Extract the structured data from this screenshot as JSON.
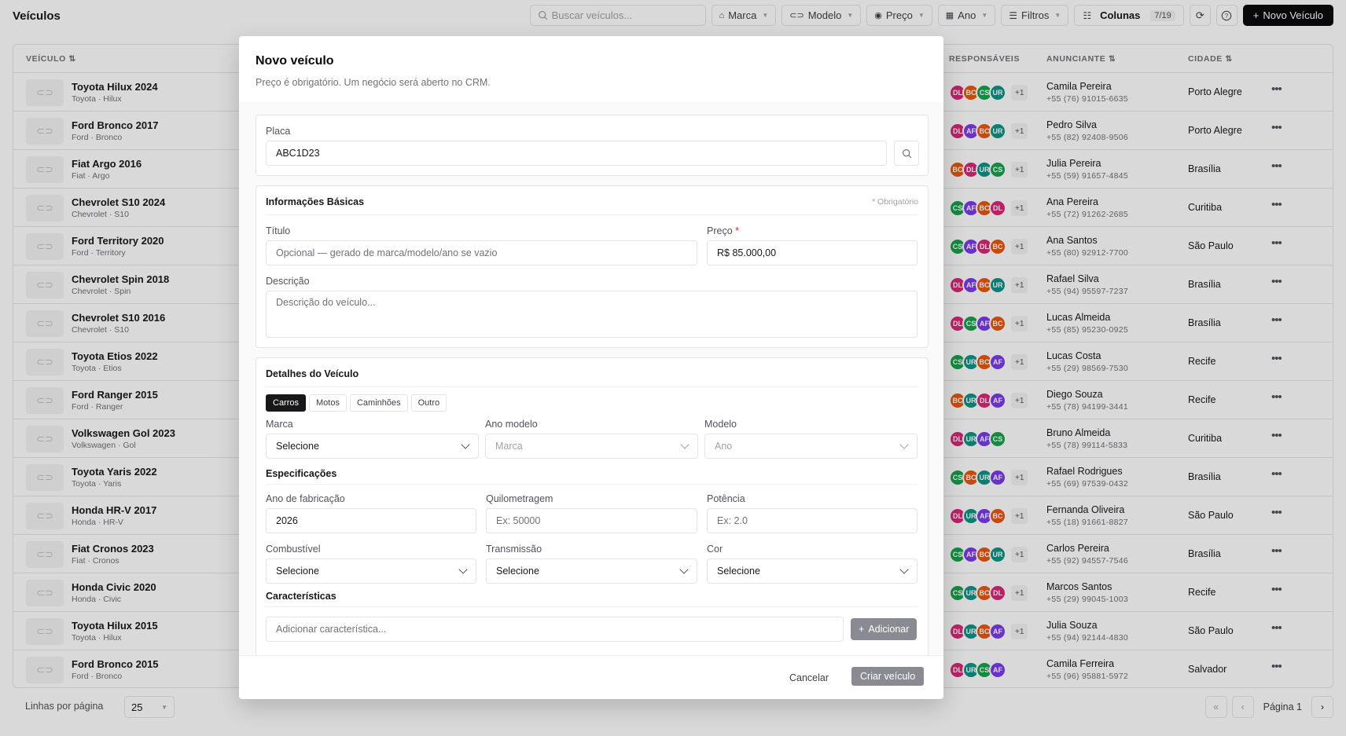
{
  "header": {
    "title": "Veículos",
    "search_placeholder": "Buscar veículos...",
    "filters": [
      "Marca",
      "Modelo",
      "Preço",
      "Ano",
      "Filtros"
    ],
    "columns_label": "Colunas",
    "columns_count": "7/19",
    "new_button": "Novo Veículo"
  },
  "table": {
    "columns": {
      "vehicle": "VEÍCULO",
      "responsibles": "RESPONSÁVEIS",
      "advertiser": "ANUNCIANTE",
      "city": "CIDADE"
    },
    "rows": [
      {
        "name": "Toyota Hilux 2024",
        "sub": "Toyota · Hilux",
        "avatars": [
          "DL",
          "BC",
          "CS",
          "UR"
        ],
        "more": "+1",
        "advertiser": "Camila Pereira",
        "phone": "+55 (76) 91015-6635",
        "city": "Porto Alegre"
      },
      {
        "name": "Ford Bronco 2017",
        "sub": "Ford · Bronco",
        "avatars": [
          "DL",
          "AF",
          "BC",
          "UR"
        ],
        "more": "+1",
        "advertiser": "Pedro Silva",
        "phone": "+55 (82) 92408-9506",
        "city": "Porto Alegre"
      },
      {
        "name": "Fiat Argo 2016",
        "sub": "Fiat · Argo",
        "avatars": [
          "BC",
          "DL",
          "UR",
          "CS"
        ],
        "more": "+1",
        "advertiser": "Julia Pereira",
        "phone": "+55 (59) 91657-4845",
        "city": "Brasília"
      },
      {
        "name": "Chevrolet S10 2024",
        "sub": "Chevrolet · S10",
        "avatars": [
          "CS",
          "AF",
          "BC",
          "DL"
        ],
        "more": "+1",
        "advertiser": "Ana Pereira",
        "phone": "+55 (72) 91262-2685",
        "city": "Curitiba"
      },
      {
        "name": "Ford Territory 2020",
        "sub": "Ford · Territory",
        "avatars": [
          "CS",
          "AF",
          "DL",
          "BC"
        ],
        "more": "+1",
        "advertiser": "Ana Santos",
        "phone": "+55 (80) 92912-7700",
        "city": "São Paulo"
      },
      {
        "name": "Chevrolet Spin 2018",
        "sub": "Chevrolet · Spin",
        "avatars": [
          "DL",
          "AF",
          "BC",
          "UR"
        ],
        "more": "+1",
        "advertiser": "Rafael Silva",
        "phone": "+55 (94) 95597-7237",
        "city": "Brasília"
      },
      {
        "name": "Chevrolet S10 2016",
        "sub": "Chevrolet · S10",
        "avatars": [
          "DL",
          "CS",
          "AF",
          "BC"
        ],
        "more": "+1",
        "advertiser": "Lucas Almeida",
        "phone": "+55 (85) 95230-0925",
        "city": "Brasília"
      },
      {
        "name": "Toyota Etios 2022",
        "sub": "Toyota · Etios",
        "avatars": [
          "CS",
          "UR",
          "BC",
          "AF"
        ],
        "more": "+1",
        "advertiser": "Lucas Costa",
        "phone": "+55 (29) 98569-7530",
        "city": "Recife"
      },
      {
        "name": "Ford Ranger 2015",
        "sub": "Ford · Ranger",
        "avatars": [
          "BC",
          "UR",
          "DL",
          "AF"
        ],
        "more": "+1",
        "advertiser": "Diego Souza",
        "phone": "+55 (78) 94199-3441",
        "city": "Recife"
      },
      {
        "name": "Volkswagen Gol 2023",
        "sub": "Volkswagen · Gol",
        "avatars": [
          "DL",
          "UR",
          "AF",
          "CS"
        ],
        "more": "",
        "advertiser": "Bruno Almeida",
        "phone": "+55 (78) 99114-5833",
        "city": "Curitiba"
      },
      {
        "name": "Toyota Yaris 2022",
        "sub": "Toyota · Yaris",
        "avatars": [
          "CS",
          "BC",
          "UR",
          "AF"
        ],
        "more": "+1",
        "advertiser": "Rafael Rodrigues",
        "phone": "+55 (69) 97539-0432",
        "city": "Brasília"
      },
      {
        "name": "Honda HR-V 2017",
        "sub": "Honda · HR-V",
        "avatars": [
          "DL",
          "UR",
          "AF",
          "BC"
        ],
        "more": "+1",
        "advertiser": "Fernanda Oliveira",
        "phone": "+55 (18) 91661-8827",
        "city": "São Paulo"
      },
      {
        "name": "Fiat Cronos 2023",
        "sub": "Fiat · Cronos",
        "avatars": [
          "CS",
          "AF",
          "BC",
          "UR"
        ],
        "more": "+1",
        "advertiser": "Carlos Pereira",
        "phone": "+55 (92) 94557-7546",
        "city": "Brasília"
      },
      {
        "name": "Honda Civic 2020",
        "sub": "Honda · Civic",
        "avatars": [
          "CS",
          "UR",
          "BC",
          "DL"
        ],
        "more": "+1",
        "advertiser": "Marcos Santos",
        "phone": "+55 (29) 99045-1003",
        "city": "Recife"
      },
      {
        "name": "Toyota Hilux 2015",
        "sub": "Toyota · Hilux",
        "avatars": [
          "DL",
          "UR",
          "BC",
          "AF"
        ],
        "more": "+1",
        "advertiser": "Julia Souza",
        "phone": "+55 (94) 92144-4830",
        "city": "São Paulo"
      },
      {
        "name": "Ford Bronco 2015",
        "sub": "Ford · Bronco",
        "avatars": [
          "DL",
          "UR",
          "CS",
          "AF"
        ],
        "more": "",
        "advertiser": "Camila Ferreira",
        "phone": "+55 (96) 95881-5972",
        "city": "Salvador"
      }
    ]
  },
  "avatar_colors": {
    "DL": "#db2777",
    "BC": "#ea580c",
    "CS": "#16a34a",
    "UR": "#0d9488",
    "AF": "#7c3aed"
  },
  "footer": {
    "rows_per_page_label": "Linhas por página",
    "rows_per_page_value": "25",
    "page_label": "Página 1"
  },
  "modal": {
    "title": "Novo veículo",
    "description": "Preço é obrigatório. Um negócio será aberto no CRM.",
    "plate": {
      "label": "Placa",
      "value": "ABC1D23"
    },
    "basic": {
      "title": "Informações Básicas",
      "required_hint": "* Obrigatório",
      "title_label": "Título",
      "title_placeholder": "Opcional — gerado de marca/modelo/ano se vazio",
      "price_label": "Preço",
      "price_required": "*",
      "price_value": "R$ 85.000,00",
      "description_label": "Descrição",
      "description_placeholder": "Descrição do veículo..."
    },
    "details": {
      "title": "Detalhes do Veículo",
      "types": [
        "Carros",
        "Motos",
        "Caminhões",
        "Outro"
      ],
      "active_type": "Carros",
      "brand_label": "Marca",
      "brand_value": "Selecione",
      "model_year_label": "Ano modelo",
      "model_year_value": "Marca",
      "model_label": "Modelo",
      "model_value": "Ano",
      "specs_title": "Especificações",
      "manufacture_year_label": "Ano de fabricação",
      "manufacture_year_value": "2026",
      "mileage_label": "Quilometragem",
      "mileage_placeholder": "Ex: 50000",
      "power_label": "Potência",
      "power_placeholder": "Ex: 2.0",
      "fuel_label": "Combustível",
      "fuel_value": "Selecione",
      "transmission_label": "Transmissão",
      "transmission_value": "Selecione",
      "color_label": "Cor",
      "color_value": "Selecione",
      "features_title": "Características",
      "feature_placeholder": "Adicionar característica...",
      "add_button": "Adicionar"
    },
    "cancel_button": "Cancelar",
    "submit_button": "Criar veículo"
  }
}
